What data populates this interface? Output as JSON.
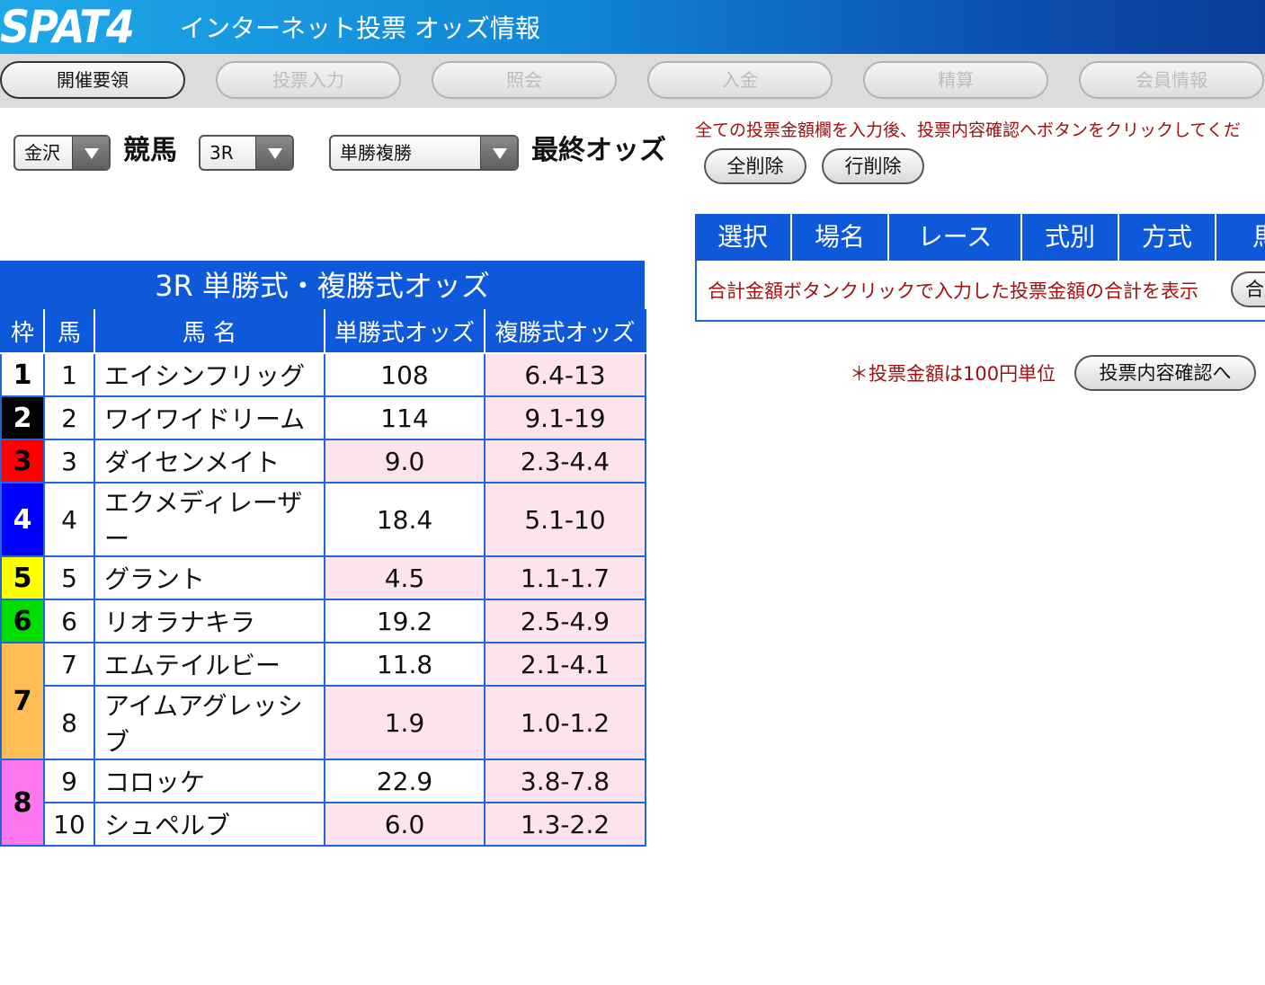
{
  "header": {
    "logo": "SPAT4",
    "title": "インターネット投票 オッズ情報"
  },
  "nav": [
    {
      "label": "開催要領",
      "active": true
    },
    {
      "label": "投票入力",
      "active": false
    },
    {
      "label": "照会",
      "active": false
    },
    {
      "label": "入金",
      "active": false
    },
    {
      "label": "精算",
      "active": false
    },
    {
      "label": "会員情報",
      "active": false
    }
  ],
  "selectors": {
    "venue": "金沢",
    "sport_label": "競馬",
    "race": "3R",
    "bet_type": "単勝複勝",
    "odds_label": "最終オッズ"
  },
  "odds_table": {
    "title": "3R 単勝式・複勝式オッズ",
    "headers": [
      "枠",
      "馬",
      "馬 名",
      "単勝式オッズ",
      "複勝式オッズ"
    ],
    "rows": [
      {
        "waku": "1",
        "num": "1",
        "name": "エイシンフリッグ",
        "win": "108",
        "place": "6.4-13"
      },
      {
        "waku": "2",
        "num": "2",
        "name": "ワイワイドリーム",
        "win": "114",
        "place": "9.1-19"
      },
      {
        "waku": "3",
        "num": "3",
        "name": "ダイセンメイト",
        "win": "9.0",
        "place": "2.3-4.4"
      },
      {
        "waku": "4",
        "num": "4",
        "name": "エクメディレーザー",
        "win": "18.4",
        "place": "5.1-10"
      },
      {
        "waku": "5",
        "num": "5",
        "name": "グラント",
        "win": "4.5",
        "place": "1.1-1.7"
      },
      {
        "waku": "6",
        "num": "6",
        "name": "リオラナキラ",
        "win": "19.2",
        "place": "2.5-4.9"
      },
      {
        "waku": "7",
        "num": "7",
        "name": "エムテイルビー",
        "win": "11.8",
        "place": "2.1-4.1"
      },
      {
        "waku": "7",
        "num": "8",
        "name": "アイムアグレッシブ",
        "win": "1.9",
        "place": "1.0-1.2"
      },
      {
        "waku": "8",
        "num": "9",
        "name": "コロッケ",
        "win": "22.9",
        "place": "3.8-7.8"
      },
      {
        "waku": "8",
        "num": "10",
        "name": "シュペルブ",
        "win": "6.0",
        "place": "1.3-2.2"
      }
    ]
  },
  "waku_colors": {
    "1": {
      "bg": "#ffffff",
      "fg": "#000000"
    },
    "2": {
      "bg": "#000000",
      "fg": "#ffffff"
    },
    "3": {
      "bg": "#ff0000",
      "fg": "#000000"
    },
    "4": {
      "bg": "#0000ff",
      "fg": "#ffffff"
    },
    "5": {
      "bg": "#ffff00",
      "fg": "#000000"
    },
    "6": {
      "bg": "#00dd00",
      "fg": "#000000"
    },
    "7": {
      "bg": "#ffbe55",
      "fg": "#000000"
    },
    "8": {
      "bg": "#ff77ee",
      "fg": "#000000"
    }
  },
  "right_panel": {
    "notice": "全ての投票金額欄を入力後、投票内容確認へボタンをクリックしてくだ",
    "clear_all": "全削除",
    "clear_row": "行削除",
    "cart_headers": [
      "選択",
      "場名",
      "レース",
      "式別",
      "方式",
      "馬"
    ],
    "total_message": "合計金額ボタンクリックで入力した投票金額の合計を表示",
    "total_button": "合",
    "unit_note": "＊投票金額は100円単位",
    "confirm_button": "投票内容確認へ"
  },
  "colors": {
    "header_blue": "#1186d6",
    "table_blue": "#0d59da",
    "pink_cell": "#fde3ec",
    "notice_red": "#a01010"
  }
}
